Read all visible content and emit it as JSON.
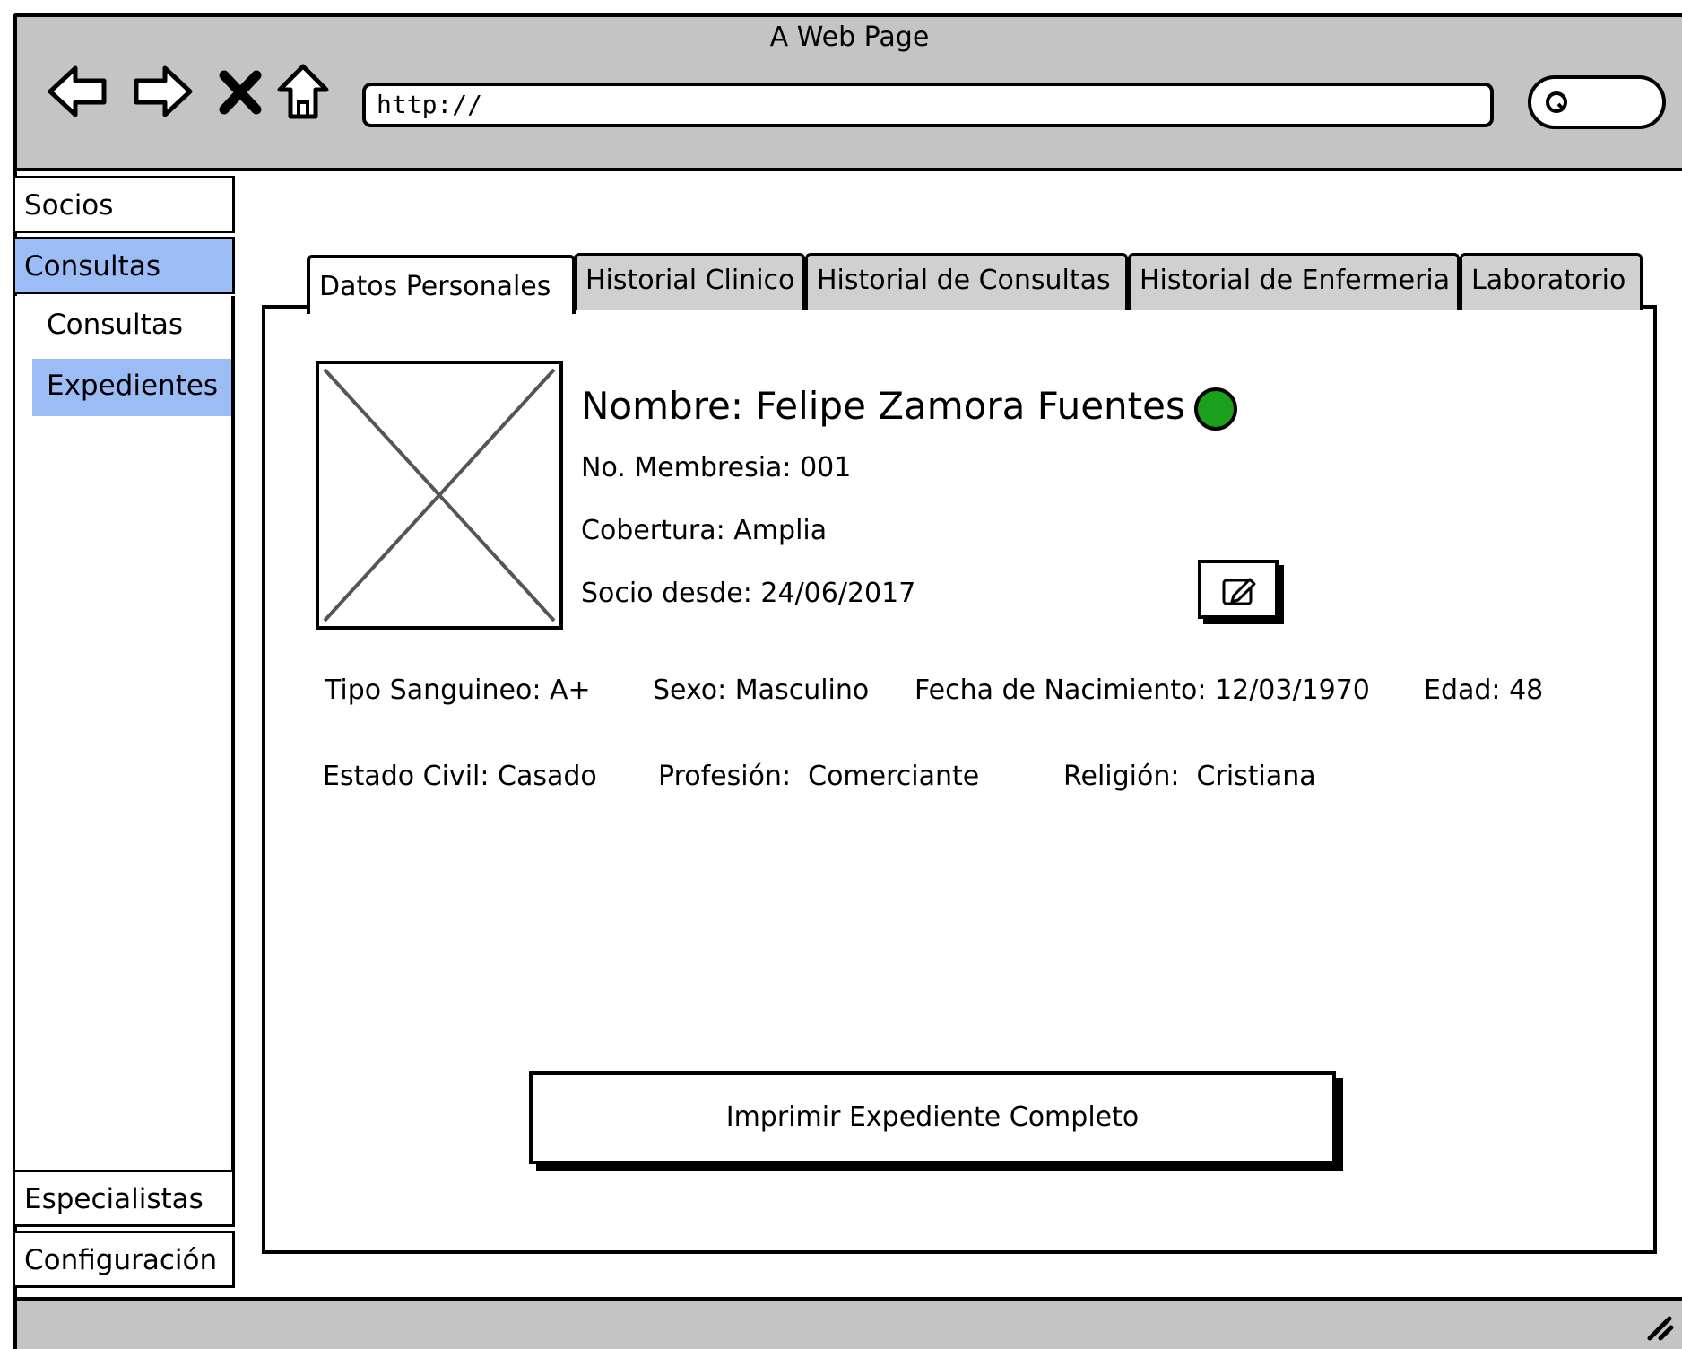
{
  "window": {
    "title": "A Web Page",
    "url": "http://"
  },
  "sidebar": {
    "items": [
      {
        "label": "Socios"
      },
      {
        "label": "Consultas"
      },
      {
        "label": "Especialistas"
      },
      {
        "label": "Configuración"
      }
    ],
    "subitems": [
      {
        "label": "Consultas"
      },
      {
        "label": "Expedientes"
      }
    ]
  },
  "tabs": [
    {
      "label": "Datos Personales"
    },
    {
      "label": "Historial Clinico"
    },
    {
      "label": "Historial de Consultas"
    },
    {
      "label": "Historial de Enfermeria"
    },
    {
      "label": "Laboratorio"
    }
  ],
  "patient": {
    "name": "Nombre: Felipe Zamora Fuentes",
    "membership": "No. Membresia: 001",
    "coverage": "Cobertura: Amplia",
    "member_since": "Socio desde: 24/06/2017",
    "blood_type": "Tipo Sanguineo: A+",
    "sex": "Sexo: Masculino",
    "birth_date": "Fecha de Nacimiento: 12/03/1970",
    "age": "Edad: 48",
    "marital_status": "Estado Civil: Casado",
    "profession": "Profesión:  Comerciante",
    "religion": "Religión:  Cristiana",
    "status_color": "#1aa01a"
  },
  "actions": {
    "print_label": "Imprimir Expediente Completo",
    "edit_icon": "edit-icon"
  },
  "colors": {
    "chrome": "#c4c4c4",
    "selected": "#9bbcf5"
  }
}
